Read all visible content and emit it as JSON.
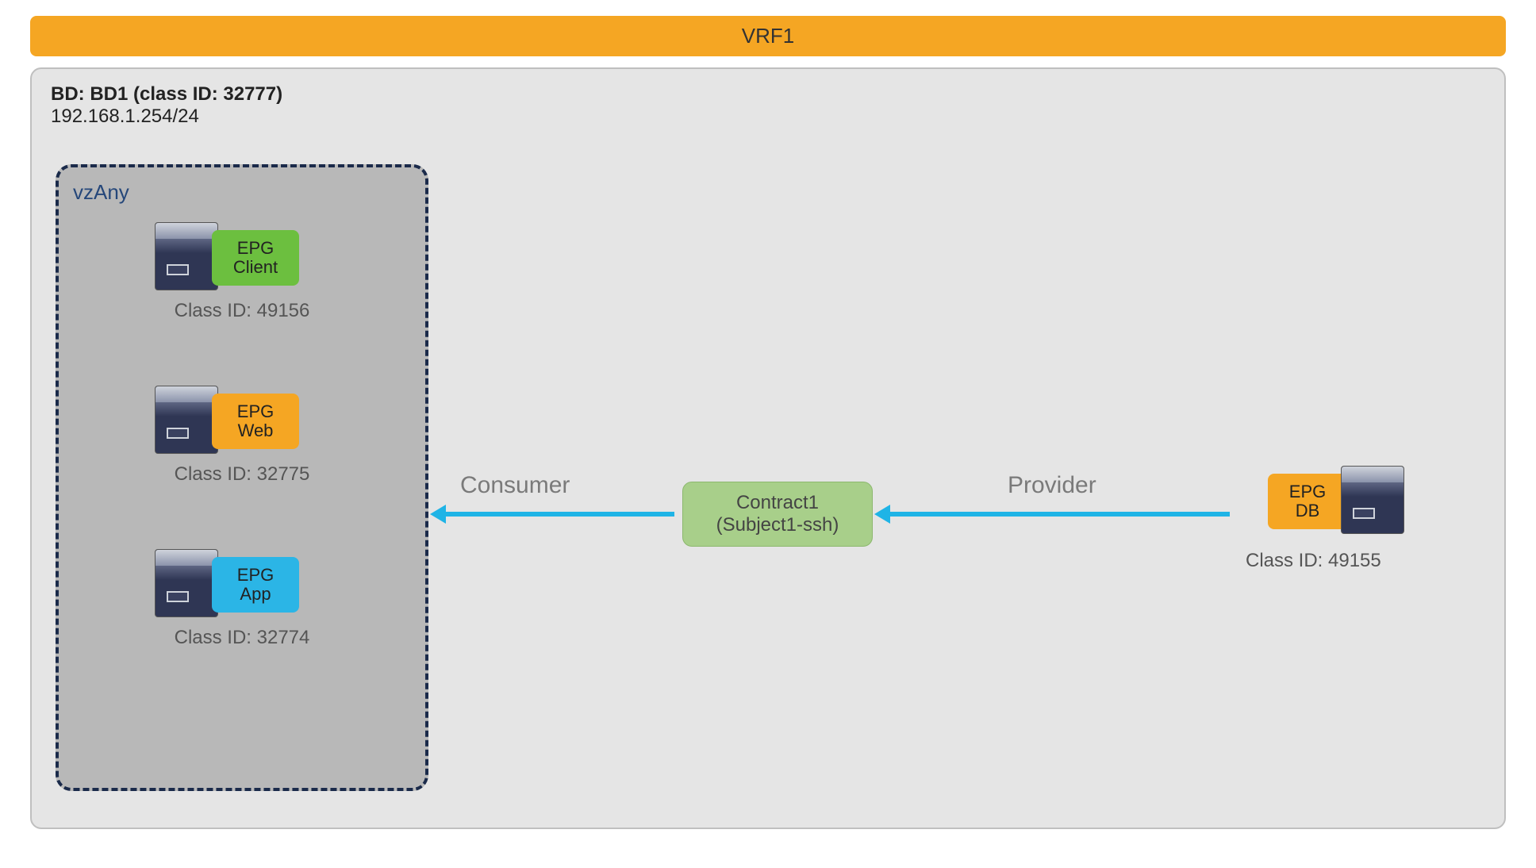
{
  "vrf": {
    "name": "VRF1"
  },
  "bd": {
    "label": "BD: BD1 (class ID: 32777)",
    "subnet": "192.168.1.254/24"
  },
  "vzany": {
    "label": "vzAny",
    "epgs": [
      {
        "line1": "EPG",
        "line2": "Client",
        "color": "green",
        "class_id": "Class ID: 49156"
      },
      {
        "line1": "EPG",
        "line2": "Web",
        "color": "orange",
        "class_id": "Class ID: 32775"
      },
      {
        "line1": "EPG",
        "line2": "App",
        "color": "blue",
        "class_id": "Class ID: 32774"
      }
    ]
  },
  "contract": {
    "line1": "Contract1",
    "line2": "(Subject1-ssh)"
  },
  "roles": {
    "consumer": "Consumer",
    "provider": "Provider"
  },
  "db_epg": {
    "line1": "EPG",
    "line2": "DB",
    "class_id": "Class ID: 49155"
  }
}
